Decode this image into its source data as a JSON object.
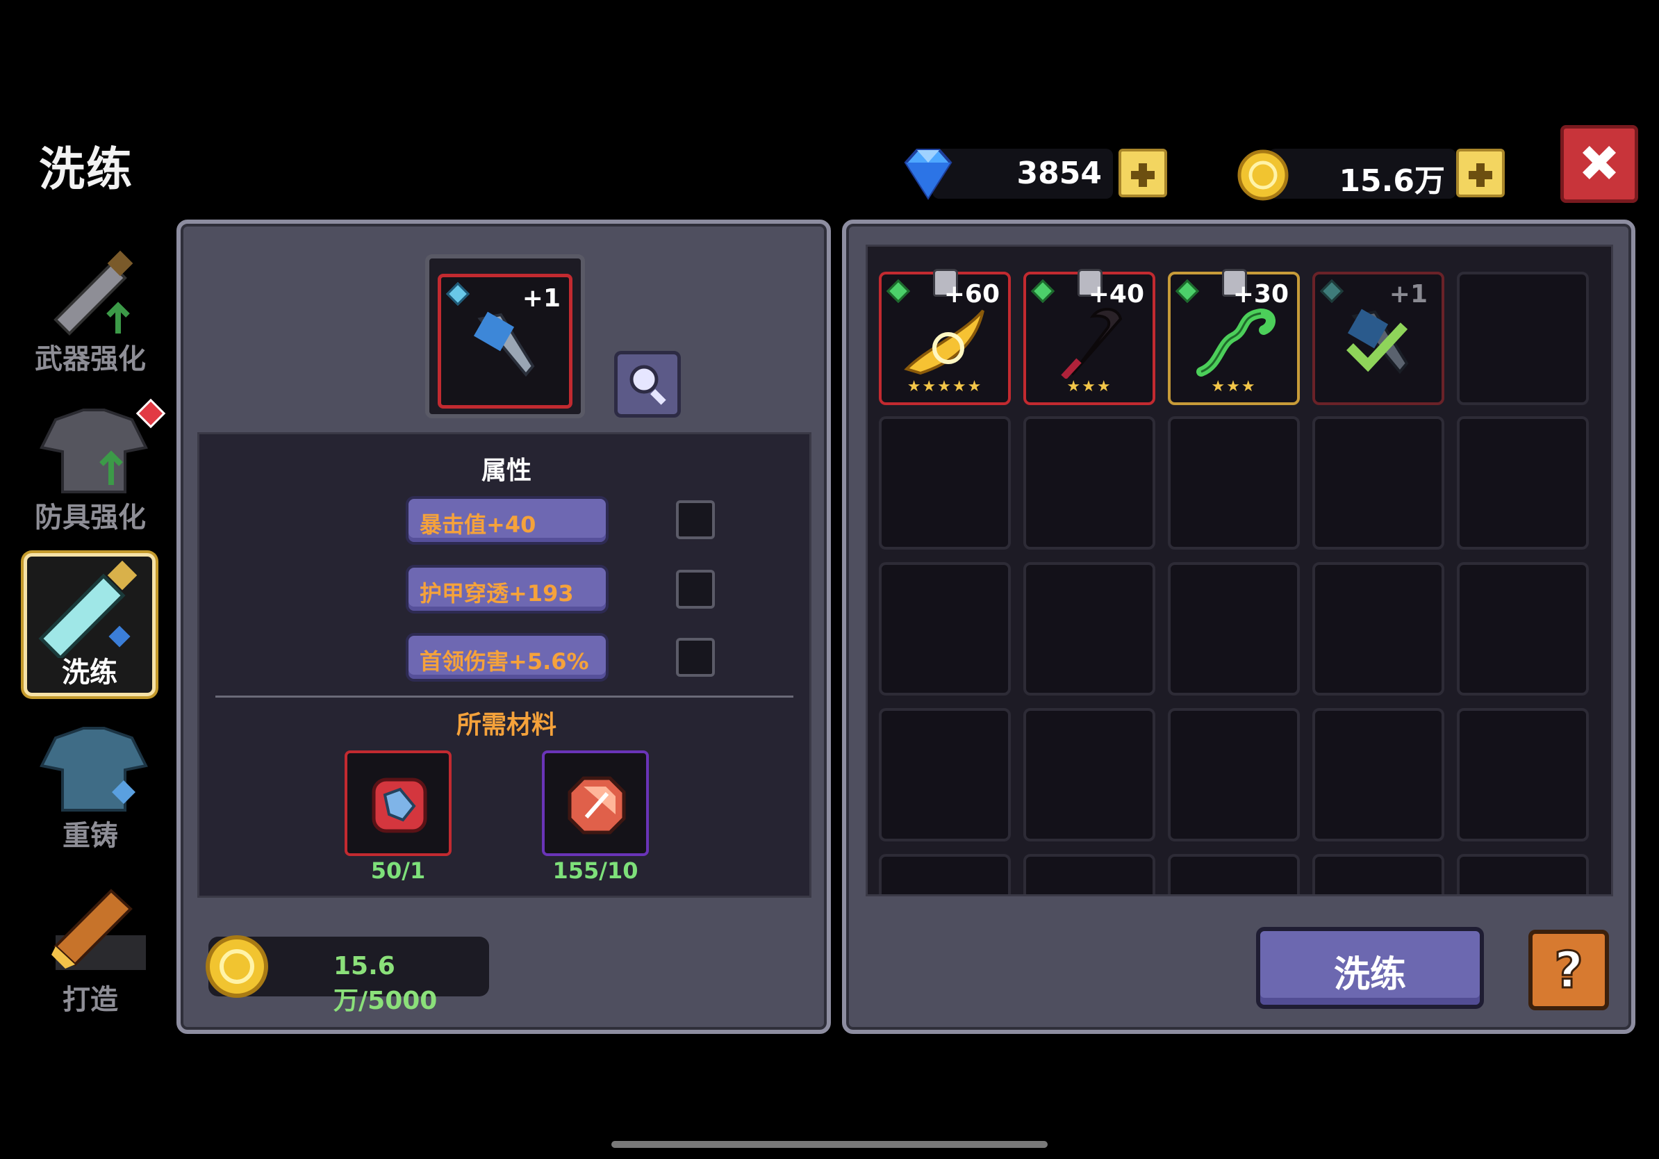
{
  "title": "洗练",
  "currency": {
    "gems": "3854",
    "coins": "15.6万"
  },
  "nav": [
    {
      "label": "武器强化",
      "icon": "sword-upgrade-icon"
    },
    {
      "label": "防具强化",
      "icon": "armor-upgrade-icon"
    },
    {
      "label": "洗练",
      "icon": "refine-sword-icon",
      "active": true
    },
    {
      "label": "重铸",
      "icon": "recast-armor-icon"
    },
    {
      "label": "打造",
      "icon": "forge-icon"
    }
  ],
  "selected_item": {
    "level": "+1",
    "icon": "blue-dagger-icon"
  },
  "attributes": {
    "heading": "属性",
    "items": [
      {
        "text": "暴击值+40"
      },
      {
        "text": "护甲穿透+193"
      },
      {
        "text": "首领伤害+5.6%"
      }
    ]
  },
  "materials": {
    "heading": "所需材料",
    "items": [
      {
        "icon": "red-ore-material-icon",
        "count": "50/1"
      },
      {
        "icon": "red-gem-material-icon",
        "count": "155/10"
      }
    ]
  },
  "cost": {
    "text": "15.6万/5000"
  },
  "inventory": [
    {
      "plus": "+60",
      "stars": "★★★★★",
      "locked": true,
      "icon": "golden-blade-icon"
    },
    {
      "plus": "+40",
      "stars": "★★★",
      "locked": true,
      "icon": "dark-scythe-icon"
    },
    {
      "plus": "+30",
      "stars": "★★★",
      "locked": true,
      "icon": "green-serpent-icon"
    },
    {
      "plus": "+1",
      "stars": "",
      "locked": false,
      "icon": "blue-dagger-selected-icon"
    }
  ],
  "buttons": {
    "refine": "洗练",
    "help": "?"
  },
  "colors": {
    "panel": "#4f4f5f",
    "accent_purple": "#6e68b2",
    "attr_text": "#f5a23b",
    "count_green": "#7ee07a",
    "close_red": "#c8343a"
  }
}
